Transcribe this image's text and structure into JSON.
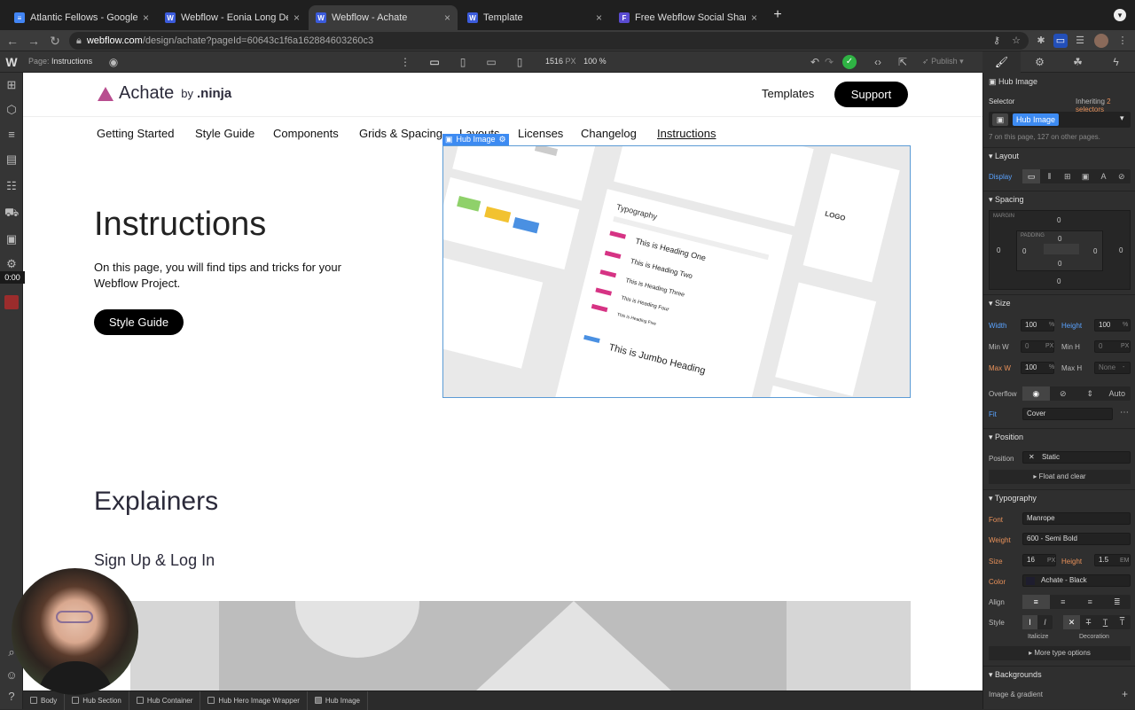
{
  "tabs": [
    {
      "title": "Atlantic Fellows - Google Docs",
      "icon": "google-docs-icon"
    },
    {
      "title": "Webflow - Eonia Long Descripti",
      "icon": "webflow-icon"
    },
    {
      "title": "Webflow - Achate",
      "icon": "webflow-icon"
    },
    {
      "title": "Template",
      "icon": "webflow-icon"
    },
    {
      "title": "Free Webflow Social Share But",
      "icon": "finsweet-icon"
    }
  ],
  "address": {
    "host": "webflow.com",
    "path": "/design/achate?pageId=60643c1f6a162884603260c3"
  },
  "designer": {
    "page_label": "Page:",
    "page_name": "Instructions",
    "canvas_width": "1516",
    "canvas_unit": "PX",
    "zoom": "100 %",
    "publish": "Publish"
  },
  "recording": {
    "timer": "0:00"
  },
  "site": {
    "brand": "Achate",
    "brand_by": "by",
    "brand_ninja": ".ninja",
    "nav_templates": "Templates",
    "nav_support": "Support",
    "menu": [
      "Getting Started",
      "Style Guide",
      "Components",
      "Grids & Spacing",
      "Layouts",
      "Licenses",
      "Changelog",
      "Instructions"
    ],
    "hero_title": "Instructions",
    "hero_text": "On this page, you will find tips and tricks for your Webflow Project.",
    "hero_button": "Style Guide",
    "selected_label": "Hub Image",
    "explainers": "Explainers",
    "signup": "Sign Up & Log In"
  },
  "hub_image": {
    "typography_title": "Typography",
    "headings": [
      "This is Heading One",
      "This is Heading Two",
      "This is Heading Three",
      "This is Heading Four",
      "This is Heading Five"
    ],
    "jumbo": "This is Jumbo Heading",
    "logo": "LOGO"
  },
  "panel": {
    "element_name": "Hub Image",
    "selector_label": "Selector",
    "inheriting": "Inheriting",
    "inheriting_count": "2 selectors",
    "selector_chip": "Hub Image",
    "usage": "7 on this page, 127 on other pages.",
    "layout": "Layout",
    "display": "Display",
    "spacing": "Spacing",
    "margin": "MARGIN",
    "padding": "PADDING",
    "zero": "0",
    "size": "Size",
    "width_label": "Width",
    "width_value": "100",
    "width_unit": "%",
    "height_label": "Height",
    "height_value": "100",
    "height_unit": "%",
    "minw_label": "Min W",
    "minw_value": "0",
    "minw_unit": "PX",
    "minh_label": "Min H",
    "minh_value": "0",
    "minh_unit": "PX",
    "maxw_label": "Max W",
    "maxw_value": "100",
    "maxw_unit": "%",
    "maxh_label": "Max H",
    "maxh_value": "None",
    "maxh_unit": "-",
    "overflow_label": "Overflow",
    "overflow_auto": "Auto",
    "fit_label": "Fit",
    "fit_value": "Cover",
    "position": "Position",
    "position_label": "Position",
    "position_value": "Static",
    "float_clear": "Float and clear",
    "typography": "Typography",
    "font_label": "Font",
    "font_value": "Manrope",
    "weight_label": "Weight",
    "weight_value": "600 - Semi Bold",
    "tsize_label": "Size",
    "tsize_value": "16",
    "tsize_unit": "PX",
    "lheight_label": "Height",
    "lheight_value": "1.5",
    "lheight_unit": "EM",
    "color_label": "Color",
    "color_value": "Achate - Black",
    "align_label": "Align",
    "style_label": "Style",
    "italicize": "Italicize",
    "decoration": "Decoration",
    "more_type": "More type options",
    "backgrounds": "Backgrounds",
    "image_gradient": "Image & gradient"
  },
  "breadcrumbs": [
    "Body",
    "Hub Section",
    "Hub Container",
    "Hub Hero Image Wrapper",
    "Hub Image"
  ],
  "colors": {
    "accent": "#3d8bf2",
    "brand_mark": "#b84d8f",
    "publish_ok": "#2fb344"
  }
}
